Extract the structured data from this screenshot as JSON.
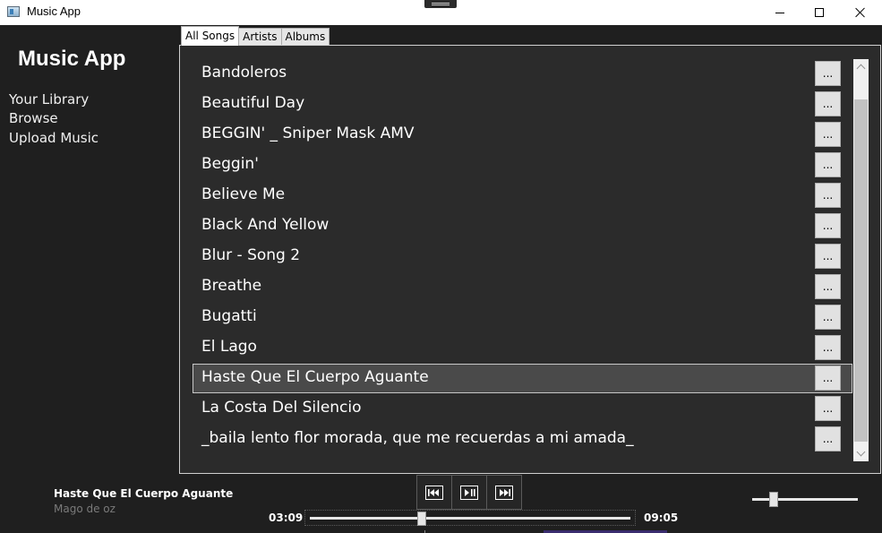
{
  "window": {
    "title": "Music App"
  },
  "sidebar": {
    "title": "Music App",
    "items": [
      {
        "label": "Your Library"
      },
      {
        "label": "Browse"
      },
      {
        "label": "Upload Music"
      }
    ]
  },
  "tabs": [
    {
      "label": "All Songs",
      "active": true
    },
    {
      "label": "Artists",
      "active": false
    },
    {
      "label": "Albums",
      "active": false
    }
  ],
  "songs": [
    {
      "title": "Bandoleros",
      "more": "..."
    },
    {
      "title": "Beautiful Day",
      "more": "..."
    },
    {
      "title": "BEGGIN' _ Sniper Mask AMV",
      "more": "..."
    },
    {
      "title": "Beggin'",
      "more": "..."
    },
    {
      "title": "Believe Me",
      "more": "..."
    },
    {
      "title": "Black And Yellow",
      "more": "..."
    },
    {
      "title": "Blur - Song 2",
      "more": "..."
    },
    {
      "title": "Breathe",
      "more": "..."
    },
    {
      "title": "Bugatti",
      "more": "..."
    },
    {
      "title": "El Lago",
      "more": "..."
    },
    {
      "title": "Haste Que El Cuerpo Aguante",
      "more": "...",
      "selected": true
    },
    {
      "title": "La Costa Del Silencio",
      "more": "..."
    },
    {
      "title": "_baila lento flor morada, que me recuerdas a mi amada_",
      "more": "..."
    }
  ],
  "player": {
    "title": "Haste Que El Cuerpo Aguante",
    "artist": "Mago de oz",
    "current_time": "03:09",
    "total_time": "09:05",
    "progress": 0.35,
    "volume": 0.2
  },
  "colors": {
    "background": "#1f1f1f",
    "panel": "#2b2b2b",
    "selected_row": "#4a4a4a",
    "text": "#ffffff",
    "muted_text": "#7a7a7a"
  },
  "icons": {
    "previous": "skip-previous-icon",
    "play_pause": "play-pause-icon",
    "next": "skip-next-icon"
  }
}
